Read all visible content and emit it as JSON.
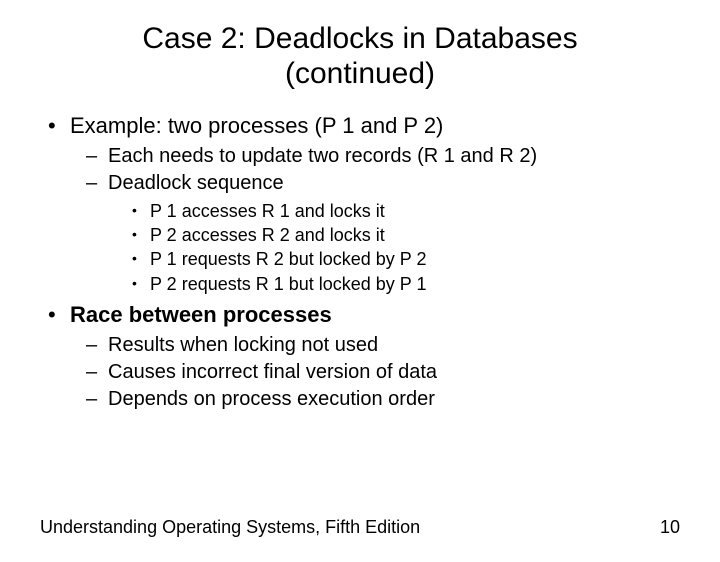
{
  "title_line1": "Case 2: Deadlocks in Databases",
  "title_line2": "(continued)",
  "b1": "Example: two processes (P 1 and P 2)",
  "b1_s1": "Each needs to update two records (R 1 and R 2)",
  "b1_s2": "Deadlock sequence",
  "b1_s2_1": "P 1 accesses R 1 and locks it",
  "b1_s2_2": "P 2 accesses R 2 and locks it",
  "b1_s2_3": "P 1 requests R 2 but locked by P 2",
  "b1_s2_4": "P 2 requests R 1 but locked by P 1",
  "b2": "Race between processes",
  "b2_s1": "Results when locking not used",
  "b2_s2": "Causes incorrect final version of data",
  "b2_s3": "Depends on process execution order",
  "footer_left": "Understanding Operating Systems, Fifth Edition",
  "footer_right": "10"
}
